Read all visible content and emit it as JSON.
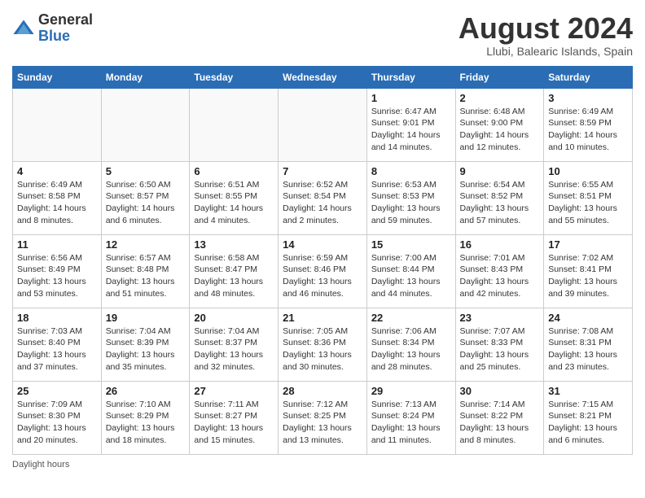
{
  "header": {
    "logo_general": "General",
    "logo_blue": "Blue",
    "main_title": "August 2024",
    "subtitle": "Llubi, Balearic Islands, Spain"
  },
  "days_of_week": [
    "Sunday",
    "Monday",
    "Tuesday",
    "Wednesday",
    "Thursday",
    "Friday",
    "Saturday"
  ],
  "weeks": [
    [
      {
        "day": "",
        "info": ""
      },
      {
        "day": "",
        "info": ""
      },
      {
        "day": "",
        "info": ""
      },
      {
        "day": "",
        "info": ""
      },
      {
        "day": "1",
        "sunrise": "6:47 AM",
        "sunset": "9:01 PM",
        "daylight": "14 hours and 14 minutes."
      },
      {
        "day": "2",
        "sunrise": "6:48 AM",
        "sunset": "9:00 PM",
        "daylight": "14 hours and 12 minutes."
      },
      {
        "day": "3",
        "sunrise": "6:49 AM",
        "sunset": "8:59 PM",
        "daylight": "14 hours and 10 minutes."
      }
    ],
    [
      {
        "day": "4",
        "sunrise": "6:49 AM",
        "sunset": "8:58 PM",
        "daylight": "14 hours and 8 minutes."
      },
      {
        "day": "5",
        "sunrise": "6:50 AM",
        "sunset": "8:57 PM",
        "daylight": "14 hours and 6 minutes."
      },
      {
        "day": "6",
        "sunrise": "6:51 AM",
        "sunset": "8:55 PM",
        "daylight": "14 hours and 4 minutes."
      },
      {
        "day": "7",
        "sunrise": "6:52 AM",
        "sunset": "8:54 PM",
        "daylight": "14 hours and 2 minutes."
      },
      {
        "day": "8",
        "sunrise": "6:53 AM",
        "sunset": "8:53 PM",
        "daylight": "13 hours and 59 minutes."
      },
      {
        "day": "9",
        "sunrise": "6:54 AM",
        "sunset": "8:52 PM",
        "daylight": "13 hours and 57 minutes."
      },
      {
        "day": "10",
        "sunrise": "6:55 AM",
        "sunset": "8:51 PM",
        "daylight": "13 hours and 55 minutes."
      }
    ],
    [
      {
        "day": "11",
        "sunrise": "6:56 AM",
        "sunset": "8:49 PM",
        "daylight": "13 hours and 53 minutes."
      },
      {
        "day": "12",
        "sunrise": "6:57 AM",
        "sunset": "8:48 PM",
        "daylight": "13 hours and 51 minutes."
      },
      {
        "day": "13",
        "sunrise": "6:58 AM",
        "sunset": "8:47 PM",
        "daylight": "13 hours and 48 minutes."
      },
      {
        "day": "14",
        "sunrise": "6:59 AM",
        "sunset": "8:46 PM",
        "daylight": "13 hours and 46 minutes."
      },
      {
        "day": "15",
        "sunrise": "7:00 AM",
        "sunset": "8:44 PM",
        "daylight": "13 hours and 44 minutes."
      },
      {
        "day": "16",
        "sunrise": "7:01 AM",
        "sunset": "8:43 PM",
        "daylight": "13 hours and 42 minutes."
      },
      {
        "day": "17",
        "sunrise": "7:02 AM",
        "sunset": "8:41 PM",
        "daylight": "13 hours and 39 minutes."
      }
    ],
    [
      {
        "day": "18",
        "sunrise": "7:03 AM",
        "sunset": "8:40 PM",
        "daylight": "13 hours and 37 minutes."
      },
      {
        "day": "19",
        "sunrise": "7:04 AM",
        "sunset": "8:39 PM",
        "daylight": "13 hours and 35 minutes."
      },
      {
        "day": "20",
        "sunrise": "7:04 AM",
        "sunset": "8:37 PM",
        "daylight": "13 hours and 32 minutes."
      },
      {
        "day": "21",
        "sunrise": "7:05 AM",
        "sunset": "8:36 PM",
        "daylight": "13 hours and 30 minutes."
      },
      {
        "day": "22",
        "sunrise": "7:06 AM",
        "sunset": "8:34 PM",
        "daylight": "13 hours and 28 minutes."
      },
      {
        "day": "23",
        "sunrise": "7:07 AM",
        "sunset": "8:33 PM",
        "daylight": "13 hours and 25 minutes."
      },
      {
        "day": "24",
        "sunrise": "7:08 AM",
        "sunset": "8:31 PM",
        "daylight": "13 hours and 23 minutes."
      }
    ],
    [
      {
        "day": "25",
        "sunrise": "7:09 AM",
        "sunset": "8:30 PM",
        "daylight": "13 hours and 20 minutes."
      },
      {
        "day": "26",
        "sunrise": "7:10 AM",
        "sunset": "8:29 PM",
        "daylight": "13 hours and 18 minutes."
      },
      {
        "day": "27",
        "sunrise": "7:11 AM",
        "sunset": "8:27 PM",
        "daylight": "13 hours and 15 minutes."
      },
      {
        "day": "28",
        "sunrise": "7:12 AM",
        "sunset": "8:25 PM",
        "daylight": "13 hours and 13 minutes."
      },
      {
        "day": "29",
        "sunrise": "7:13 AM",
        "sunset": "8:24 PM",
        "daylight": "13 hours and 11 minutes."
      },
      {
        "day": "30",
        "sunrise": "7:14 AM",
        "sunset": "8:22 PM",
        "daylight": "13 hours and 8 minutes."
      },
      {
        "day": "31",
        "sunrise": "7:15 AM",
        "sunset": "8:21 PM",
        "daylight": "13 hours and 6 minutes."
      }
    ]
  ],
  "footer": {
    "daylight_label": "Daylight hours"
  }
}
